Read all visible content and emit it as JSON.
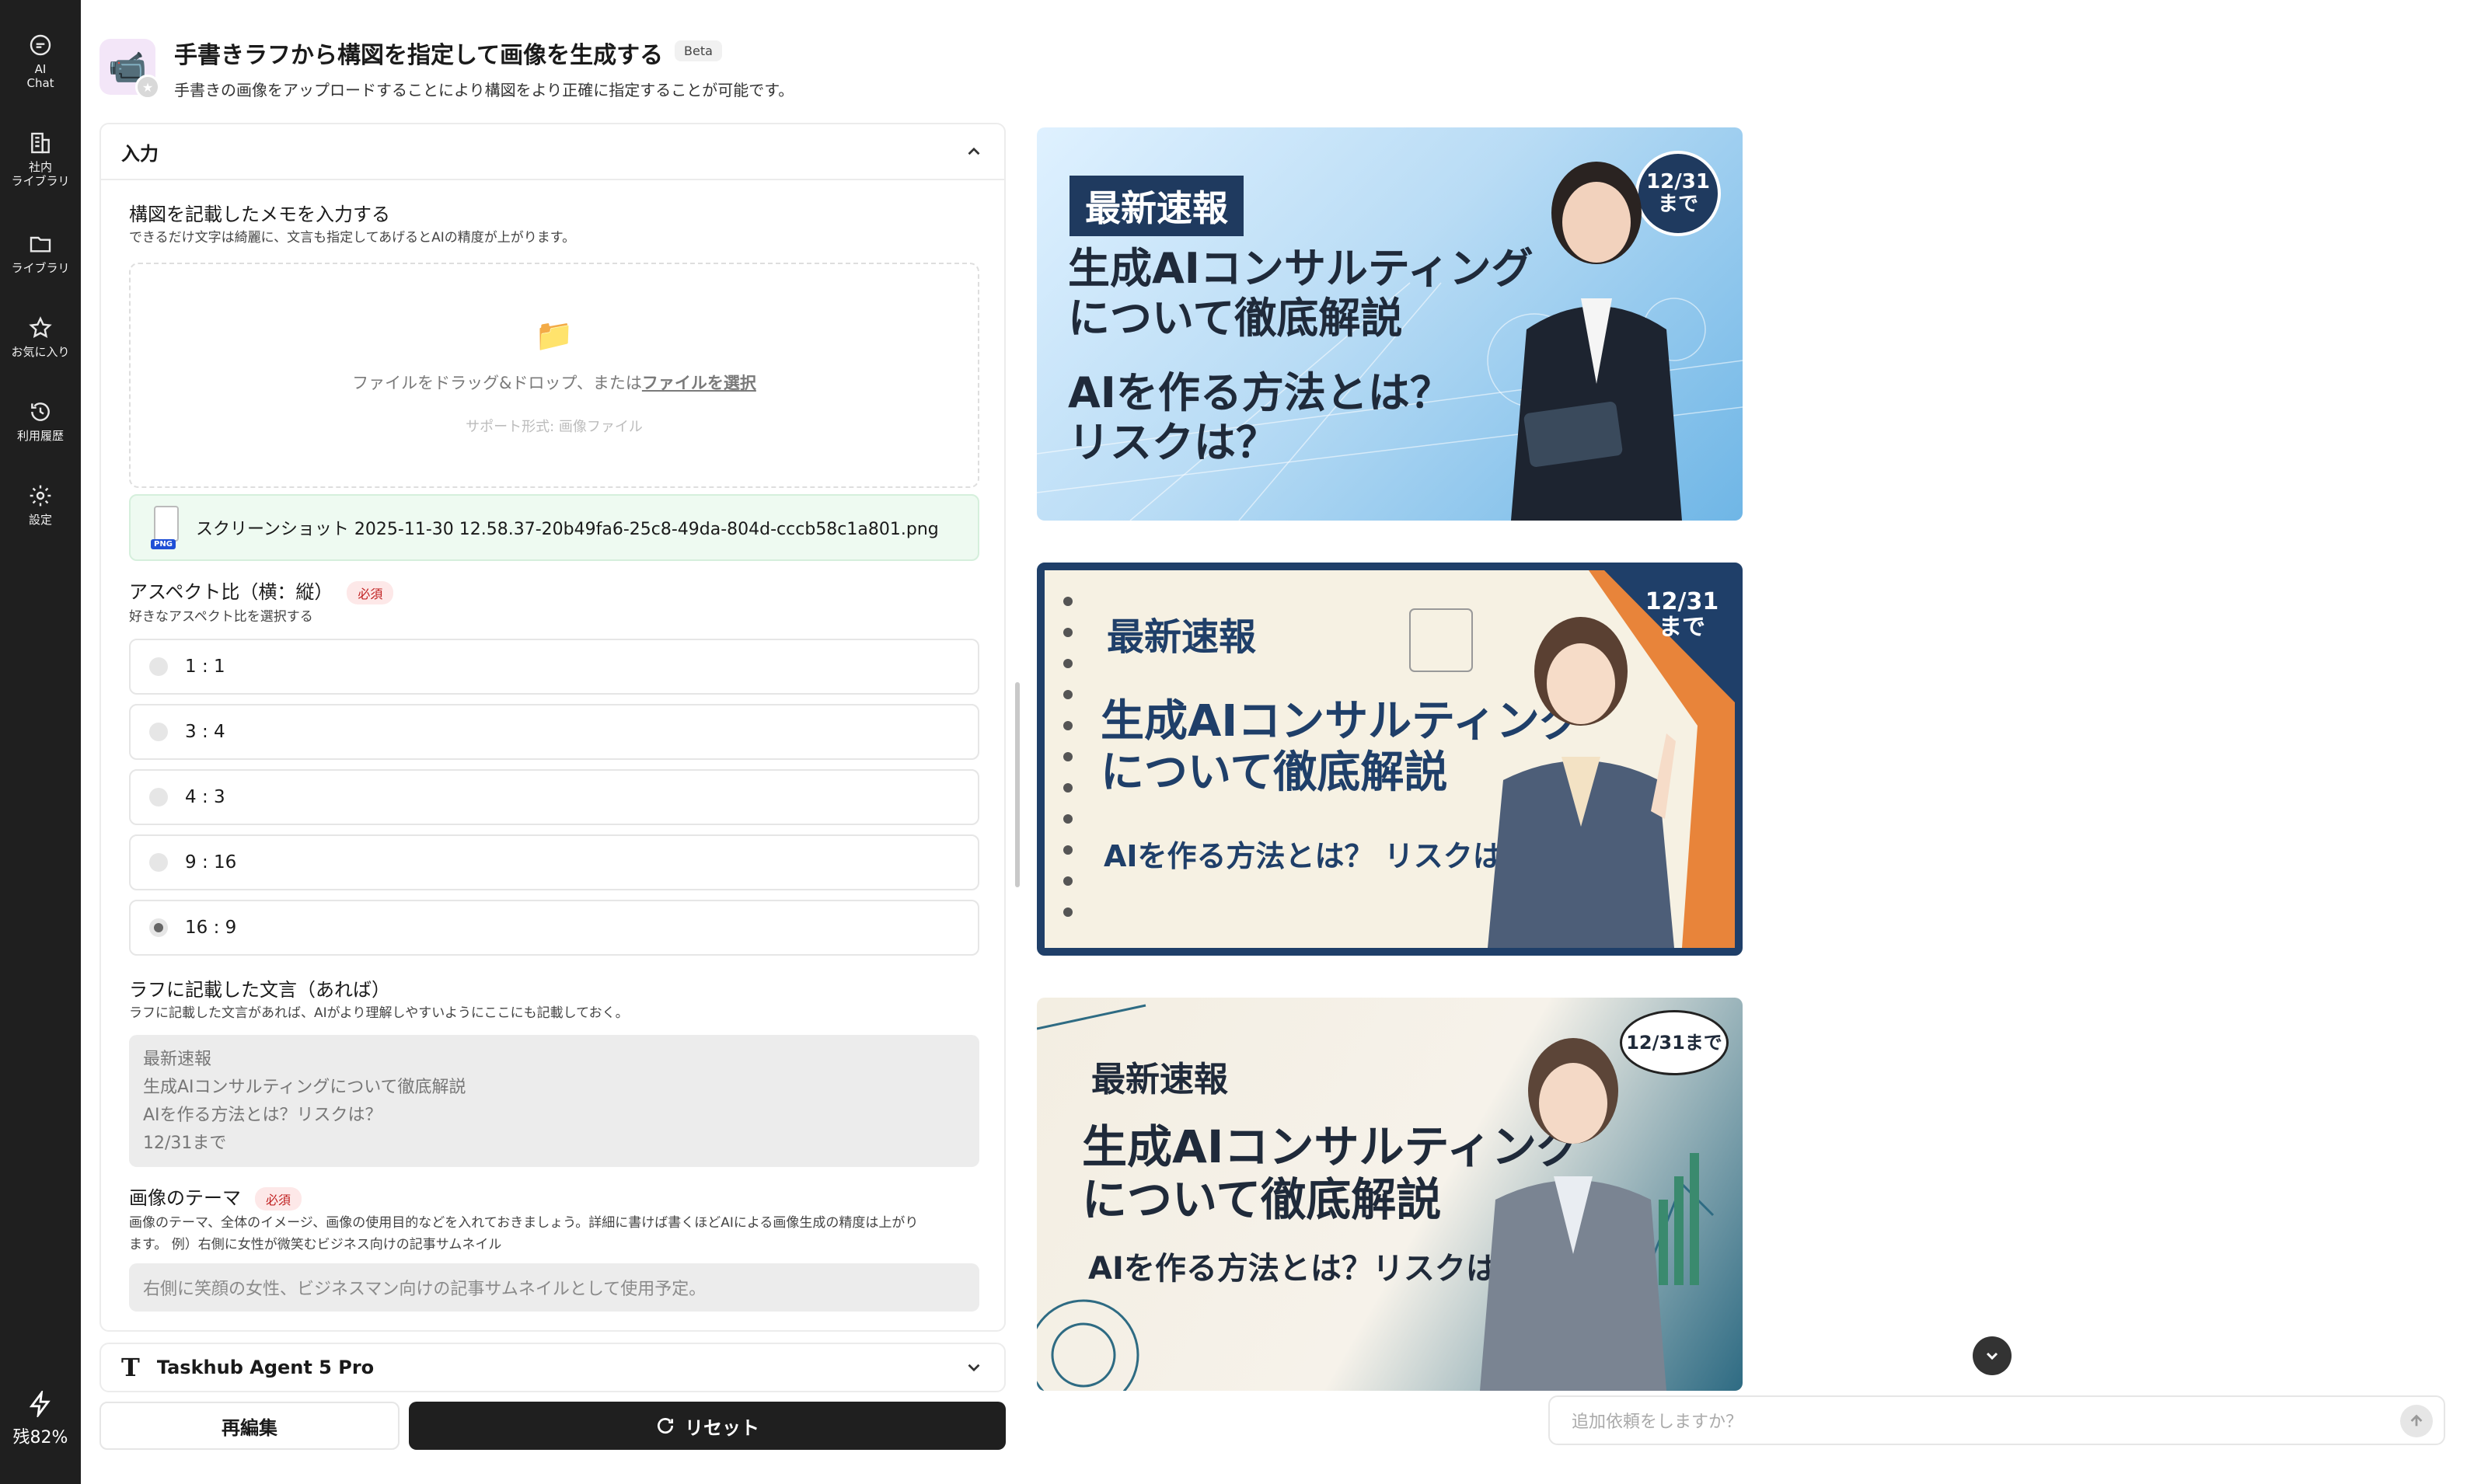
{
  "sidebar": {
    "items": [
      {
        "label": "AI\nChat",
        "icon": "chat-bubble-icon"
      },
      {
        "label": "社内\nライブラリ",
        "icon": "building-icon"
      },
      {
        "label": "ライブラリ",
        "icon": "folder-icon"
      },
      {
        "label": "お気に入り",
        "icon": "star-icon"
      },
      {
        "label": "利用履歴",
        "icon": "history-icon"
      },
      {
        "label": "設定",
        "icon": "gear-icon"
      }
    ],
    "remaining": "残82%"
  },
  "header": {
    "title": "手書きラフから構図を指定して画像を生成する",
    "badge": "Beta",
    "subtitle": "手書きの画像をアップロードすることにより構図をより正確に指定することが可能です。"
  },
  "input_panel": {
    "title": "入力",
    "memo": {
      "label": "構図を記載したメモを入力する",
      "help": "できるだけ文字は綺麗に、文言も指定してあげるとAIの精度が上がります。",
      "drop_text": "ファイルをドラッグ&ドロップ、または",
      "drop_link": "ファイルを選択",
      "supported": "サポート形式: 画像ファイル",
      "file_name": "スクリーンショット 2025-11-30 12.58.37-20b49fa6-25c8-49da-804d-cccb58c1a801.png",
      "file_tag": "PNG"
    },
    "aspect": {
      "label": "アスペクト比（横：縦）",
      "required": "必須",
      "help": "好きなアスペクト比を選択する",
      "options": [
        "1 : 1",
        "3 : 4",
        "4 : 3",
        "9 : 16",
        "16 : 9"
      ],
      "selected": "16 : 9"
    },
    "text": {
      "label": "ラフに記載した文言（あれば）",
      "help": "ラフに記載した文言があれば、AIがより理解しやすいようにここにも記載しておく。",
      "value": "最新速報\n生成AIコンサルティングについて徹底解説\nAIを作る方法とは？リスクは？\n12/31まで"
    },
    "theme": {
      "label": "画像のテーマ",
      "required": "必須",
      "help1": "画像のテーマ、全体のイメージ、画像の使用目的などを入れておきましょう。詳細に書けば書くほどAIによる画像生成の精度は上がり",
      "help2": "ます。 例）右側に女性が微笑むビジネス向けの記事サムネイル",
      "placeholder": "右側に笑顔の女性、ビジネスマン向けの記事サムネイルとして使用予定。"
    }
  },
  "model": {
    "name": "Taskhub Agent 5 Pro",
    "icon_letter": "T"
  },
  "buttons": {
    "edit": "再編集",
    "reset": "リセット"
  },
  "results": [
    {
      "tag": "最新速報",
      "headline": "生成AIコンサルティング\nについて徹底解説",
      "sub": "AIを作る方法とは？\nリスクは？",
      "sticker": "12/31\nまで"
    },
    {
      "tag": "最新速報",
      "headline": "生成AIコンサルティング\nについて徹底解説",
      "sub": "AIを作る方法とは？ リスクは？",
      "sticker": "12/31\nまで"
    },
    {
      "tag": "最新速報",
      "headline": "生成AIコンサルティング\nについて徹底解説",
      "sub": "AIを作る方法とは？リスクは？",
      "sticker": "12/31まで"
    }
  ],
  "chat": {
    "placeholder": "追加依頼をしますか？"
  },
  "colors": {
    "rail": "#1f1f1f",
    "accent_dark": "#1f3a5f",
    "required_bg": "#fde8e8",
    "file_bg": "#eefaf1"
  }
}
